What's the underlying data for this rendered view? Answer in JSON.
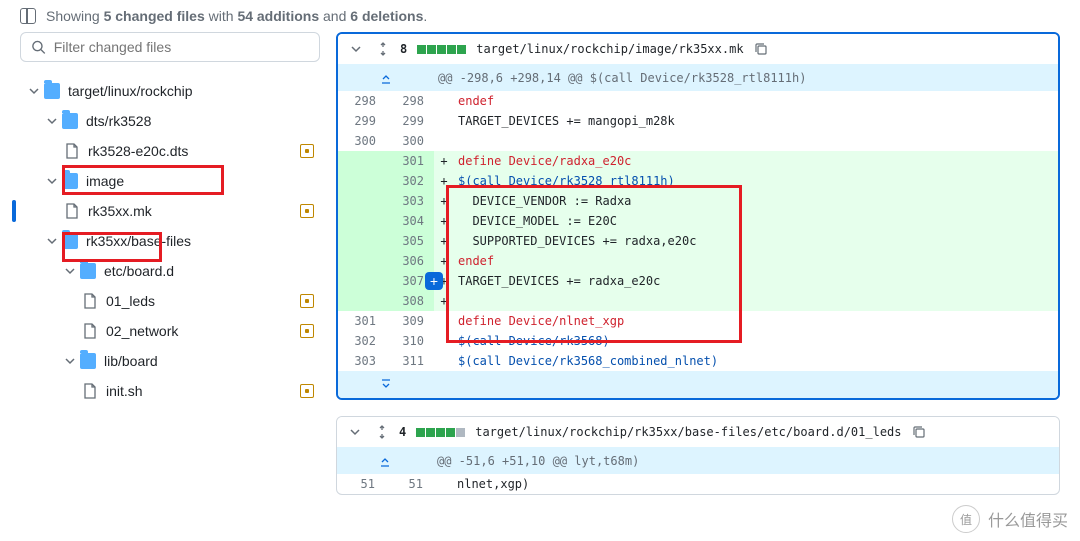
{
  "header": {
    "text_before": "Showing ",
    "files_bold": "5 changed files",
    "text_mid": " with ",
    "adds_bold": "54 additions",
    "text_and": " and ",
    "dels_bold": "6 deletions",
    "text_end": "."
  },
  "search": {
    "placeholder": "Filter changed files"
  },
  "tree": {
    "l0": "target/linux/rockchip",
    "l1": "dts/rk3528",
    "l1f": "rk3528-e20c.dts",
    "l2": "image",
    "l2f": "rk35xx.mk",
    "l3": "rk35xx/base-files",
    "l4": "etc/board.d",
    "l4f1": "01_leds",
    "l4f2": "02_network",
    "l5": "lib/board",
    "l5f": "init.sh"
  },
  "diff1": {
    "count": "8",
    "path": "target/linux/rockchip/image/rk35xx.mk",
    "hunk": "@@ -298,6 +298,14 @@ $(call Device/rk3528_rtl8111h)",
    "rows": [
      {
        "o": "298",
        "n": "298",
        "m": " ",
        "c": "endef",
        "cls": "red",
        "add": false
      },
      {
        "o": "299",
        "n": "299",
        "m": " ",
        "c": "TARGET_DEVICES += mangopi_m28k",
        "cls": "",
        "add": false
      },
      {
        "o": "300",
        "n": "300",
        "m": " ",
        "c": "",
        "cls": "",
        "add": false
      },
      {
        "o": "",
        "n": "301",
        "m": "+",
        "c": "define Device/radxa_e20c",
        "cls": "red",
        "add": true
      },
      {
        "o": "",
        "n": "302",
        "m": "+",
        "c": "$(call Device/rk3528_rtl8111h)",
        "cls": "blue",
        "add": true
      },
      {
        "o": "",
        "n": "303",
        "m": "+",
        "c": "  DEVICE_VENDOR := Radxa",
        "cls": "",
        "add": true
      },
      {
        "o": "",
        "n": "304",
        "m": "+",
        "c": "  DEVICE_MODEL := E20C",
        "cls": "",
        "add": true
      },
      {
        "o": "",
        "n": "305",
        "m": "+",
        "c": "  SUPPORTED_DEVICES += radxa,e20c",
        "cls": "",
        "add": true
      },
      {
        "o": "",
        "n": "306",
        "m": "+",
        "c": "endef",
        "cls": "red",
        "add": true
      },
      {
        "o": "",
        "n": "307",
        "m": "+",
        "c": "TARGET_DEVICES += radxa_e20c",
        "cls": "",
        "add": true
      },
      {
        "o": "",
        "n": "308",
        "m": "+",
        "c": "",
        "cls": "",
        "add": true
      },
      {
        "o": "301",
        "n": "309",
        "m": " ",
        "c": "define Device/nlnet_xgp",
        "cls": "red",
        "add": false
      },
      {
        "o": "302",
        "n": "310",
        "m": " ",
        "c": "$(call Device/rk3568)",
        "cls": "blue",
        "add": false
      },
      {
        "o": "303",
        "n": "311",
        "m": " ",
        "c": "$(call Device/rk3568_combined_nlnet)",
        "cls": "blue",
        "add": false
      }
    ]
  },
  "diff2": {
    "count": "4",
    "path": "target/linux/rockchip/rk35xx/base-files/etc/board.d/01_leds",
    "hunk": "@@ -51,6 +51,10 @@ lyt,t68m)",
    "rows": [
      {
        "o": "51",
        "n": "51",
        "m": " ",
        "c": "nlnet,xgp)",
        "cls": "",
        "add": false
      }
    ]
  },
  "watermark": {
    "badge": "值",
    "text": "什么值得买"
  }
}
